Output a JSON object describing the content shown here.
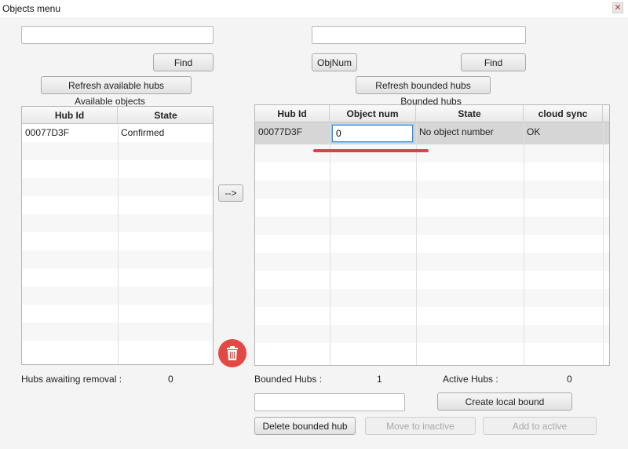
{
  "window": {
    "title": "Objects menu",
    "close_glyph": "✕"
  },
  "left": {
    "search_value": "",
    "find_label": "Find",
    "refresh_label": "Refresh available hubs",
    "section_label": "Available objects",
    "columns": [
      "Hub Id",
      "State"
    ],
    "rows": [
      {
        "hub_id": "00077D3F",
        "state": "Confirmed"
      }
    ],
    "awaiting_label": "Hubs awaiting removal :",
    "awaiting_value": "0"
  },
  "transfer": {
    "arrow_label": "-->"
  },
  "delete_icon": "trash-icon",
  "right": {
    "search_value": "",
    "objnum_label": "ObjNum",
    "find_label": "Find",
    "refresh_label": "Refresh bounded hubs",
    "section_label": "Bounded hubs",
    "columns": [
      "Hub Id",
      "Object num",
      "State",
      "cloud sync"
    ],
    "rows": [
      {
        "hub_id": "00077D3F",
        "object_num": "0",
        "state": "No object number",
        "cloud_sync": "OK"
      }
    ],
    "bounded_label": "Bounded Hubs :",
    "bounded_value": "1",
    "active_label": "Active Hubs :",
    "active_value": "0",
    "local_bound_value": "",
    "create_local_label": "Create local bound",
    "delete_label": "Delete bounded hub",
    "move_inactive_label": "Move to inactive",
    "add_active_label": "Add to active"
  },
  "colors": {
    "accent_red": "#d9434b",
    "selection_blue": "#3a8fd8"
  }
}
